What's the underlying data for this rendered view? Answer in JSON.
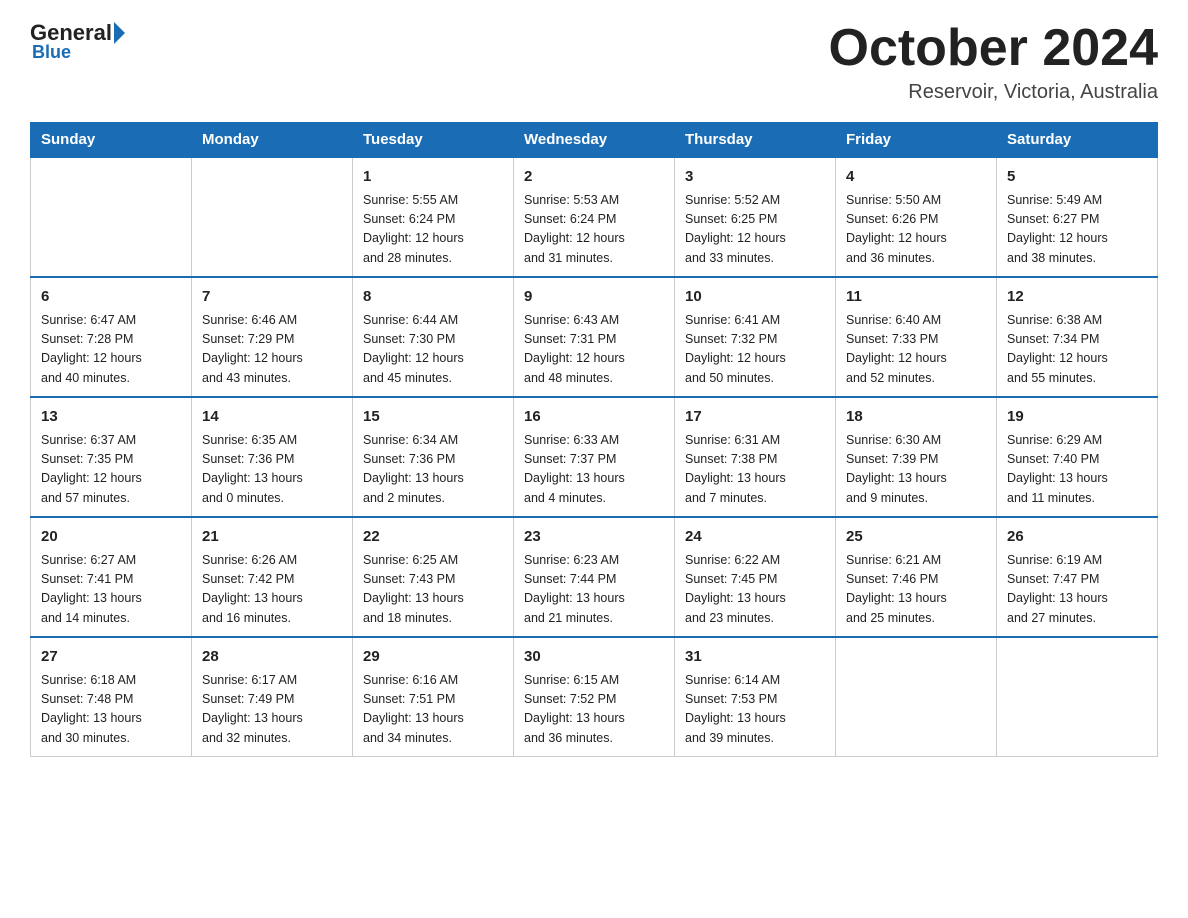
{
  "logo": {
    "general": "General",
    "blue": "Blue"
  },
  "header": {
    "title": "October 2024",
    "location": "Reservoir, Victoria, Australia"
  },
  "days_of_week": [
    "Sunday",
    "Monday",
    "Tuesday",
    "Wednesday",
    "Thursday",
    "Friday",
    "Saturday"
  ],
  "weeks": [
    [
      {
        "day": "",
        "info": ""
      },
      {
        "day": "",
        "info": ""
      },
      {
        "day": "1",
        "info": "Sunrise: 5:55 AM\nSunset: 6:24 PM\nDaylight: 12 hours\nand 28 minutes."
      },
      {
        "day": "2",
        "info": "Sunrise: 5:53 AM\nSunset: 6:24 PM\nDaylight: 12 hours\nand 31 minutes."
      },
      {
        "day": "3",
        "info": "Sunrise: 5:52 AM\nSunset: 6:25 PM\nDaylight: 12 hours\nand 33 minutes."
      },
      {
        "day": "4",
        "info": "Sunrise: 5:50 AM\nSunset: 6:26 PM\nDaylight: 12 hours\nand 36 minutes."
      },
      {
        "day": "5",
        "info": "Sunrise: 5:49 AM\nSunset: 6:27 PM\nDaylight: 12 hours\nand 38 minutes."
      }
    ],
    [
      {
        "day": "6",
        "info": "Sunrise: 6:47 AM\nSunset: 7:28 PM\nDaylight: 12 hours\nand 40 minutes."
      },
      {
        "day": "7",
        "info": "Sunrise: 6:46 AM\nSunset: 7:29 PM\nDaylight: 12 hours\nand 43 minutes."
      },
      {
        "day": "8",
        "info": "Sunrise: 6:44 AM\nSunset: 7:30 PM\nDaylight: 12 hours\nand 45 minutes."
      },
      {
        "day": "9",
        "info": "Sunrise: 6:43 AM\nSunset: 7:31 PM\nDaylight: 12 hours\nand 48 minutes."
      },
      {
        "day": "10",
        "info": "Sunrise: 6:41 AM\nSunset: 7:32 PM\nDaylight: 12 hours\nand 50 minutes."
      },
      {
        "day": "11",
        "info": "Sunrise: 6:40 AM\nSunset: 7:33 PM\nDaylight: 12 hours\nand 52 minutes."
      },
      {
        "day": "12",
        "info": "Sunrise: 6:38 AM\nSunset: 7:34 PM\nDaylight: 12 hours\nand 55 minutes."
      }
    ],
    [
      {
        "day": "13",
        "info": "Sunrise: 6:37 AM\nSunset: 7:35 PM\nDaylight: 12 hours\nand 57 minutes."
      },
      {
        "day": "14",
        "info": "Sunrise: 6:35 AM\nSunset: 7:36 PM\nDaylight: 13 hours\nand 0 minutes."
      },
      {
        "day": "15",
        "info": "Sunrise: 6:34 AM\nSunset: 7:36 PM\nDaylight: 13 hours\nand 2 minutes."
      },
      {
        "day": "16",
        "info": "Sunrise: 6:33 AM\nSunset: 7:37 PM\nDaylight: 13 hours\nand 4 minutes."
      },
      {
        "day": "17",
        "info": "Sunrise: 6:31 AM\nSunset: 7:38 PM\nDaylight: 13 hours\nand 7 minutes."
      },
      {
        "day": "18",
        "info": "Sunrise: 6:30 AM\nSunset: 7:39 PM\nDaylight: 13 hours\nand 9 minutes."
      },
      {
        "day": "19",
        "info": "Sunrise: 6:29 AM\nSunset: 7:40 PM\nDaylight: 13 hours\nand 11 minutes."
      }
    ],
    [
      {
        "day": "20",
        "info": "Sunrise: 6:27 AM\nSunset: 7:41 PM\nDaylight: 13 hours\nand 14 minutes."
      },
      {
        "day": "21",
        "info": "Sunrise: 6:26 AM\nSunset: 7:42 PM\nDaylight: 13 hours\nand 16 minutes."
      },
      {
        "day": "22",
        "info": "Sunrise: 6:25 AM\nSunset: 7:43 PM\nDaylight: 13 hours\nand 18 minutes."
      },
      {
        "day": "23",
        "info": "Sunrise: 6:23 AM\nSunset: 7:44 PM\nDaylight: 13 hours\nand 21 minutes."
      },
      {
        "day": "24",
        "info": "Sunrise: 6:22 AM\nSunset: 7:45 PM\nDaylight: 13 hours\nand 23 minutes."
      },
      {
        "day": "25",
        "info": "Sunrise: 6:21 AM\nSunset: 7:46 PM\nDaylight: 13 hours\nand 25 minutes."
      },
      {
        "day": "26",
        "info": "Sunrise: 6:19 AM\nSunset: 7:47 PM\nDaylight: 13 hours\nand 27 minutes."
      }
    ],
    [
      {
        "day": "27",
        "info": "Sunrise: 6:18 AM\nSunset: 7:48 PM\nDaylight: 13 hours\nand 30 minutes."
      },
      {
        "day": "28",
        "info": "Sunrise: 6:17 AM\nSunset: 7:49 PM\nDaylight: 13 hours\nand 32 minutes."
      },
      {
        "day": "29",
        "info": "Sunrise: 6:16 AM\nSunset: 7:51 PM\nDaylight: 13 hours\nand 34 minutes."
      },
      {
        "day": "30",
        "info": "Sunrise: 6:15 AM\nSunset: 7:52 PM\nDaylight: 13 hours\nand 36 minutes."
      },
      {
        "day": "31",
        "info": "Sunrise: 6:14 AM\nSunset: 7:53 PM\nDaylight: 13 hours\nand 39 minutes."
      },
      {
        "day": "",
        "info": ""
      },
      {
        "day": "",
        "info": ""
      }
    ]
  ]
}
